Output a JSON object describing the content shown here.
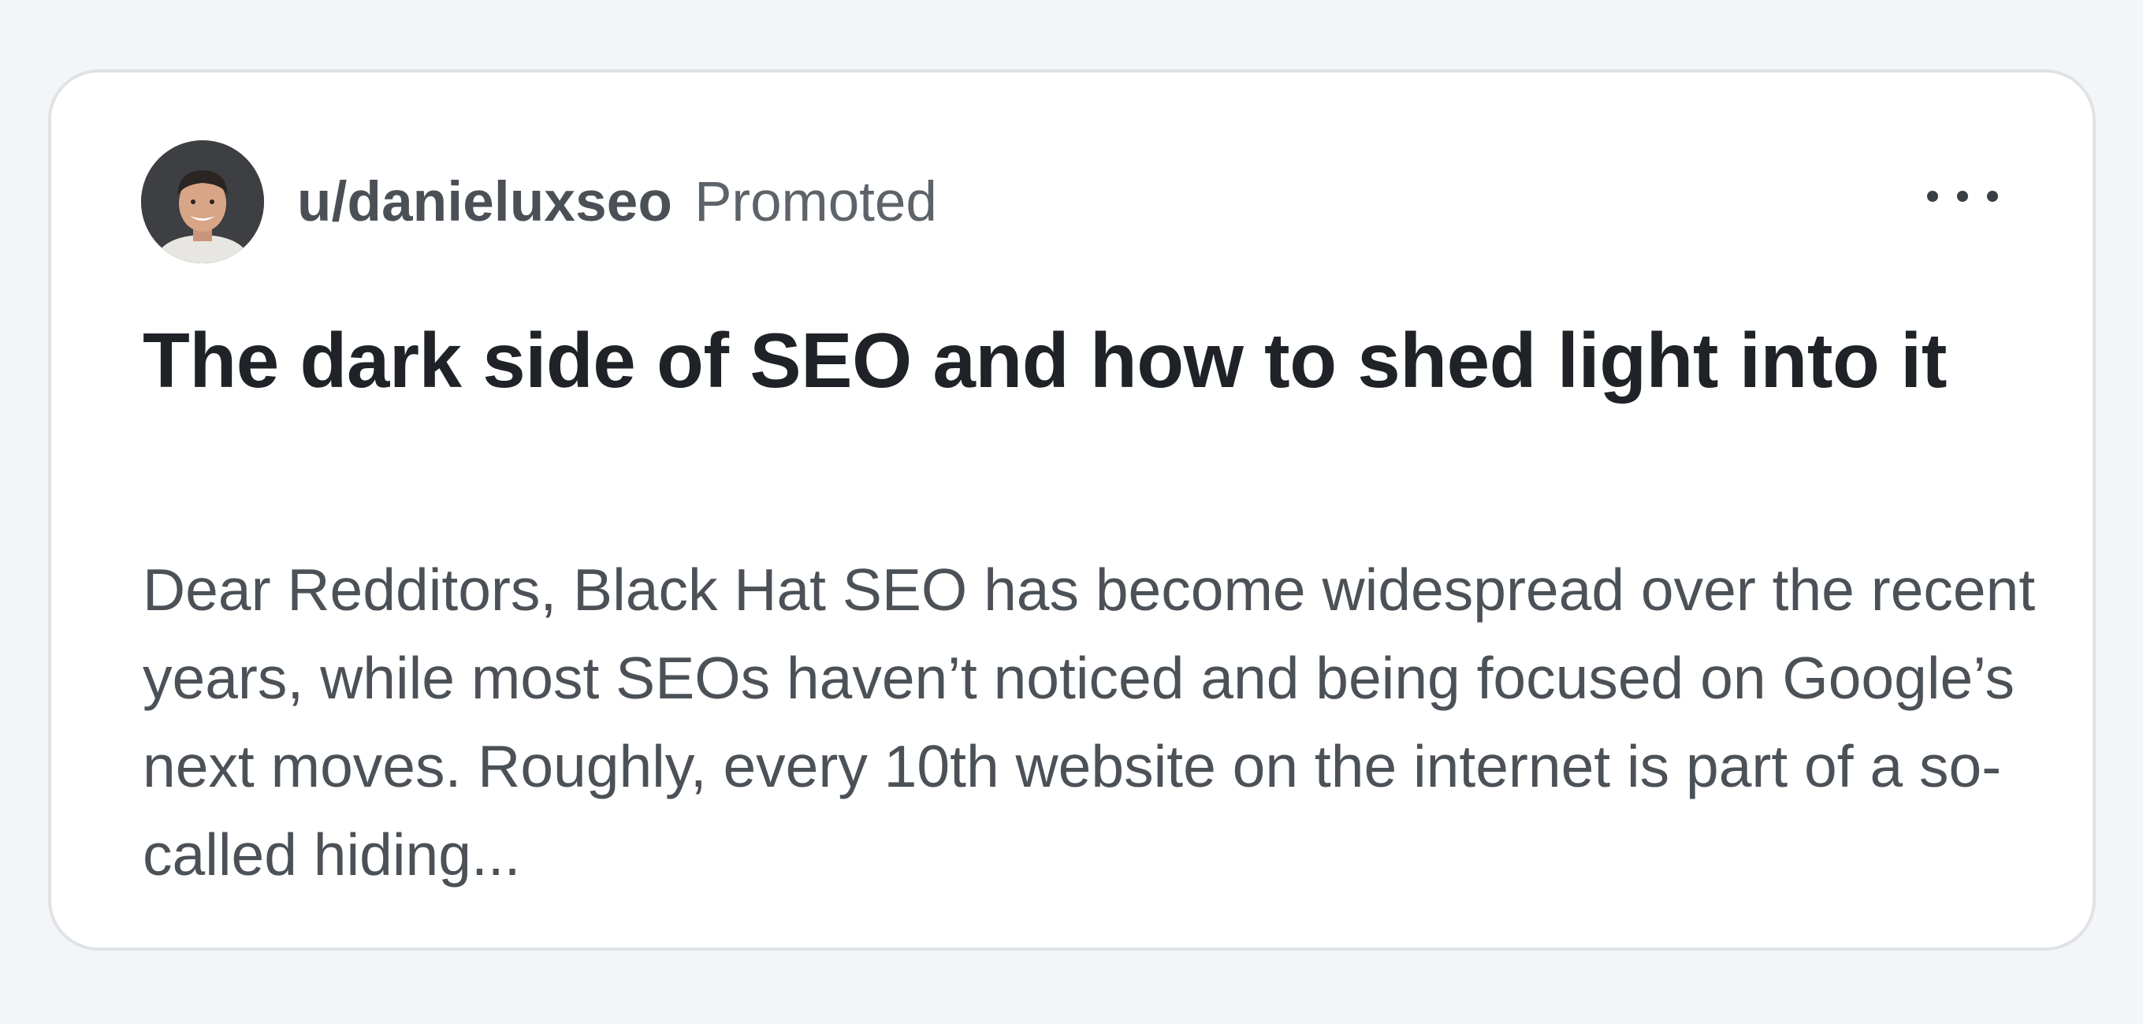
{
  "post": {
    "username": "u/danieluxseo",
    "promoted_label": "Promoted",
    "title": "The dark side of SEO and how to shed light into it",
    "body": "Dear Redditors, Black Hat SEO has become widespread over the recent years, while most SEOs haven’t noticed and being focused on Google’s next moves. Roughly, every 10th website on the internet is part of a so-called hiding...",
    "avatar_icon": "user-avatar",
    "menu_icon": "more-options-icon"
  },
  "colors": {
    "background": "#f4f5f6",
    "card": "#ffffff",
    "border": "#dfe3e7",
    "title": "#1f2328",
    "body_text": "#4b5157",
    "meta_text": "#5d6369"
  }
}
